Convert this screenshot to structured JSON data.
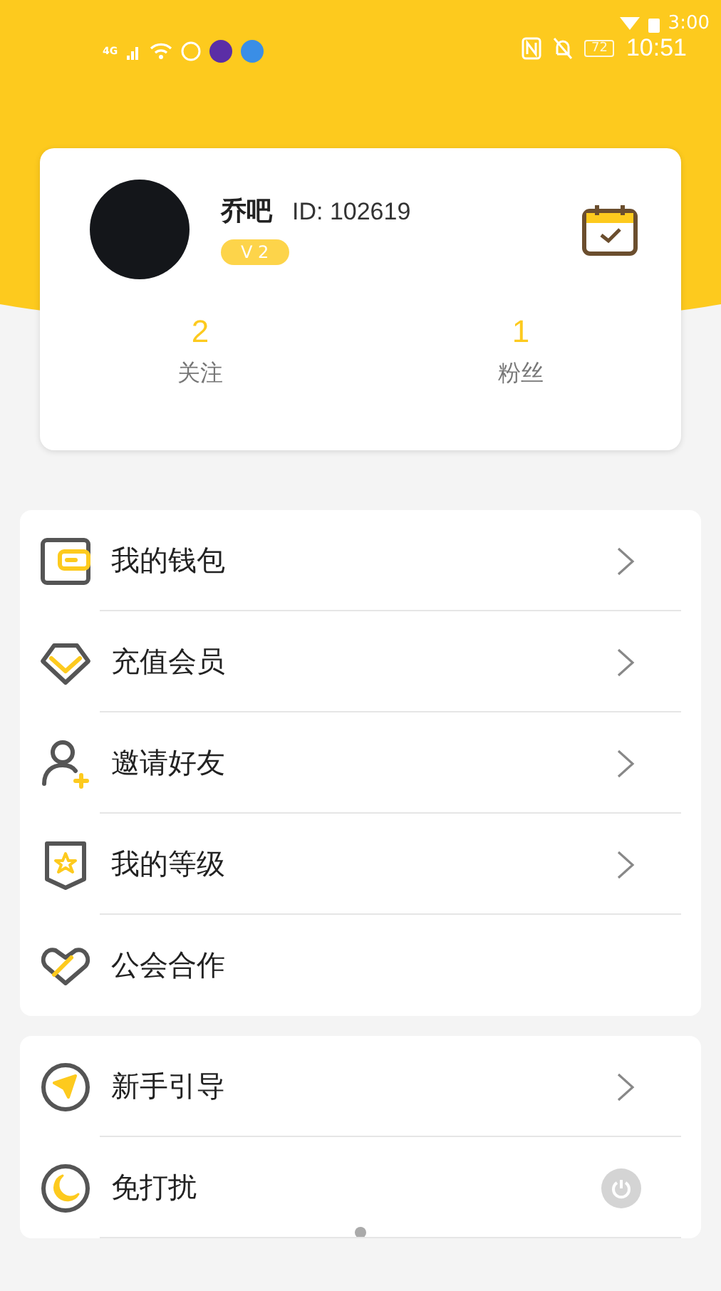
{
  "status_bar": {
    "secondary_time": "3:00",
    "battery": "72",
    "time": "10:51",
    "network": "4G"
  },
  "profile": {
    "name": "乔吧",
    "id": "ID: 102619",
    "level_badge": "V 2",
    "stats": [
      {
        "value": "2",
        "label": "关注"
      },
      {
        "value": "1",
        "label": "粉丝"
      }
    ]
  },
  "menu_groups": [
    {
      "items": [
        {
          "kind": "link",
          "label": "我的钱包"
        },
        {
          "kind": "link",
          "label": "充值会员"
        },
        {
          "kind": "link",
          "label": "邀请好友"
        },
        {
          "kind": "link",
          "label": "我的等级"
        },
        {
          "kind": "plain",
          "label": "公会合作"
        }
      ]
    },
    {
      "items": [
        {
          "kind": "link",
          "label": "新手引导"
        },
        {
          "kind": "toggle",
          "label": "免打扰",
          "on": false
        }
      ]
    }
  ]
}
